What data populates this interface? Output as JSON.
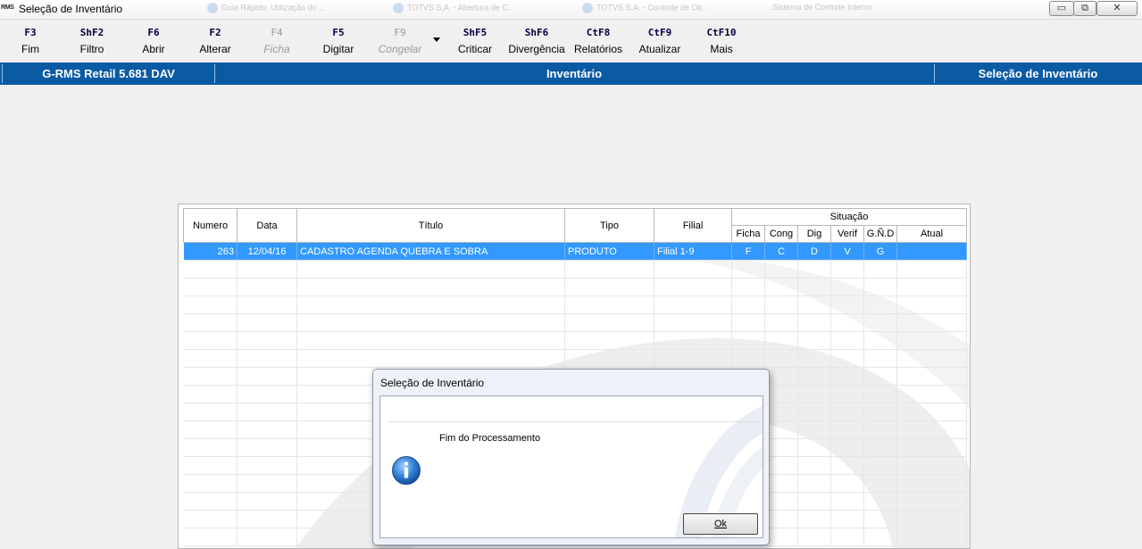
{
  "window": {
    "logo_text": "RMS",
    "title": "Seleção de Inventário",
    "background_tabs": [
      "Guia Rápido: Utilização do ...",
      "TOTVS S.A. - Abertura de C...",
      "TOTVS S.A. - Controle de Ob...",
      "Sistema de Controle Interno"
    ],
    "controls": {
      "minimize": "▭",
      "maximize": "⧉",
      "close": "✕"
    }
  },
  "toolbar": {
    "items": [
      {
        "key": "F3",
        "label": "Fim",
        "enabled": true
      },
      {
        "key": "ShF2",
        "label": "Filtro",
        "enabled": true
      },
      {
        "key": "F6",
        "label": "Abrir",
        "enabled": true
      },
      {
        "key": "F2",
        "label": "Alterar",
        "enabled": true
      },
      {
        "key": "F4",
        "label": "Ficha",
        "enabled": false
      },
      {
        "key": "F5",
        "label": "Digitar",
        "enabled": true
      },
      {
        "key": "F9",
        "label": "Congelar",
        "enabled": false
      },
      {
        "key": "ShF5",
        "label": "Criticar",
        "enabled": true
      },
      {
        "key": "ShF6",
        "label": "Divergência",
        "enabled": true
      },
      {
        "key": "CtF8",
        "label": "Relatórios",
        "enabled": true
      },
      {
        "key": "CtF9",
        "label": "Atualizar",
        "enabled": true
      },
      {
        "key": "CtF10",
        "label": "Mais",
        "enabled": true
      }
    ]
  },
  "header": {
    "app": "G-RMS Retail 5.681 DAV",
    "module": "Inventário",
    "screen": "Seleção de Inventário"
  },
  "grid": {
    "columns": {
      "numero": "Numero",
      "data": "Data",
      "titulo": "Título",
      "tipo": "Tipo",
      "filial": "Filial",
      "situacao": "Situação",
      "ficha": "Ficha",
      "cong": "Cong",
      "dig": "Dig",
      "verif": "Verif",
      "gnd": "G.Ñ.D",
      "atual": "Atual"
    },
    "rows": [
      {
        "numero": "263",
        "data": "12/04/16",
        "titulo": "CADASTRO AGENDA QUEBRA E SOBRA",
        "tipo": "PRODUTO",
        "filial": "Filial 1-9",
        "ficha": "F",
        "cong": "C",
        "dig": "D",
        "verif": "V",
        "gnd": "G",
        "atual": ""
      }
    ]
  },
  "dialog": {
    "title": "Seleção de Inventário",
    "message": "Fim do Processamento",
    "icon": "info-icon",
    "ok_label": "Ok"
  },
  "colors": {
    "header_bar": "#0a5aa4",
    "selected_row": "#3399ff",
    "key_text": "#000040"
  }
}
